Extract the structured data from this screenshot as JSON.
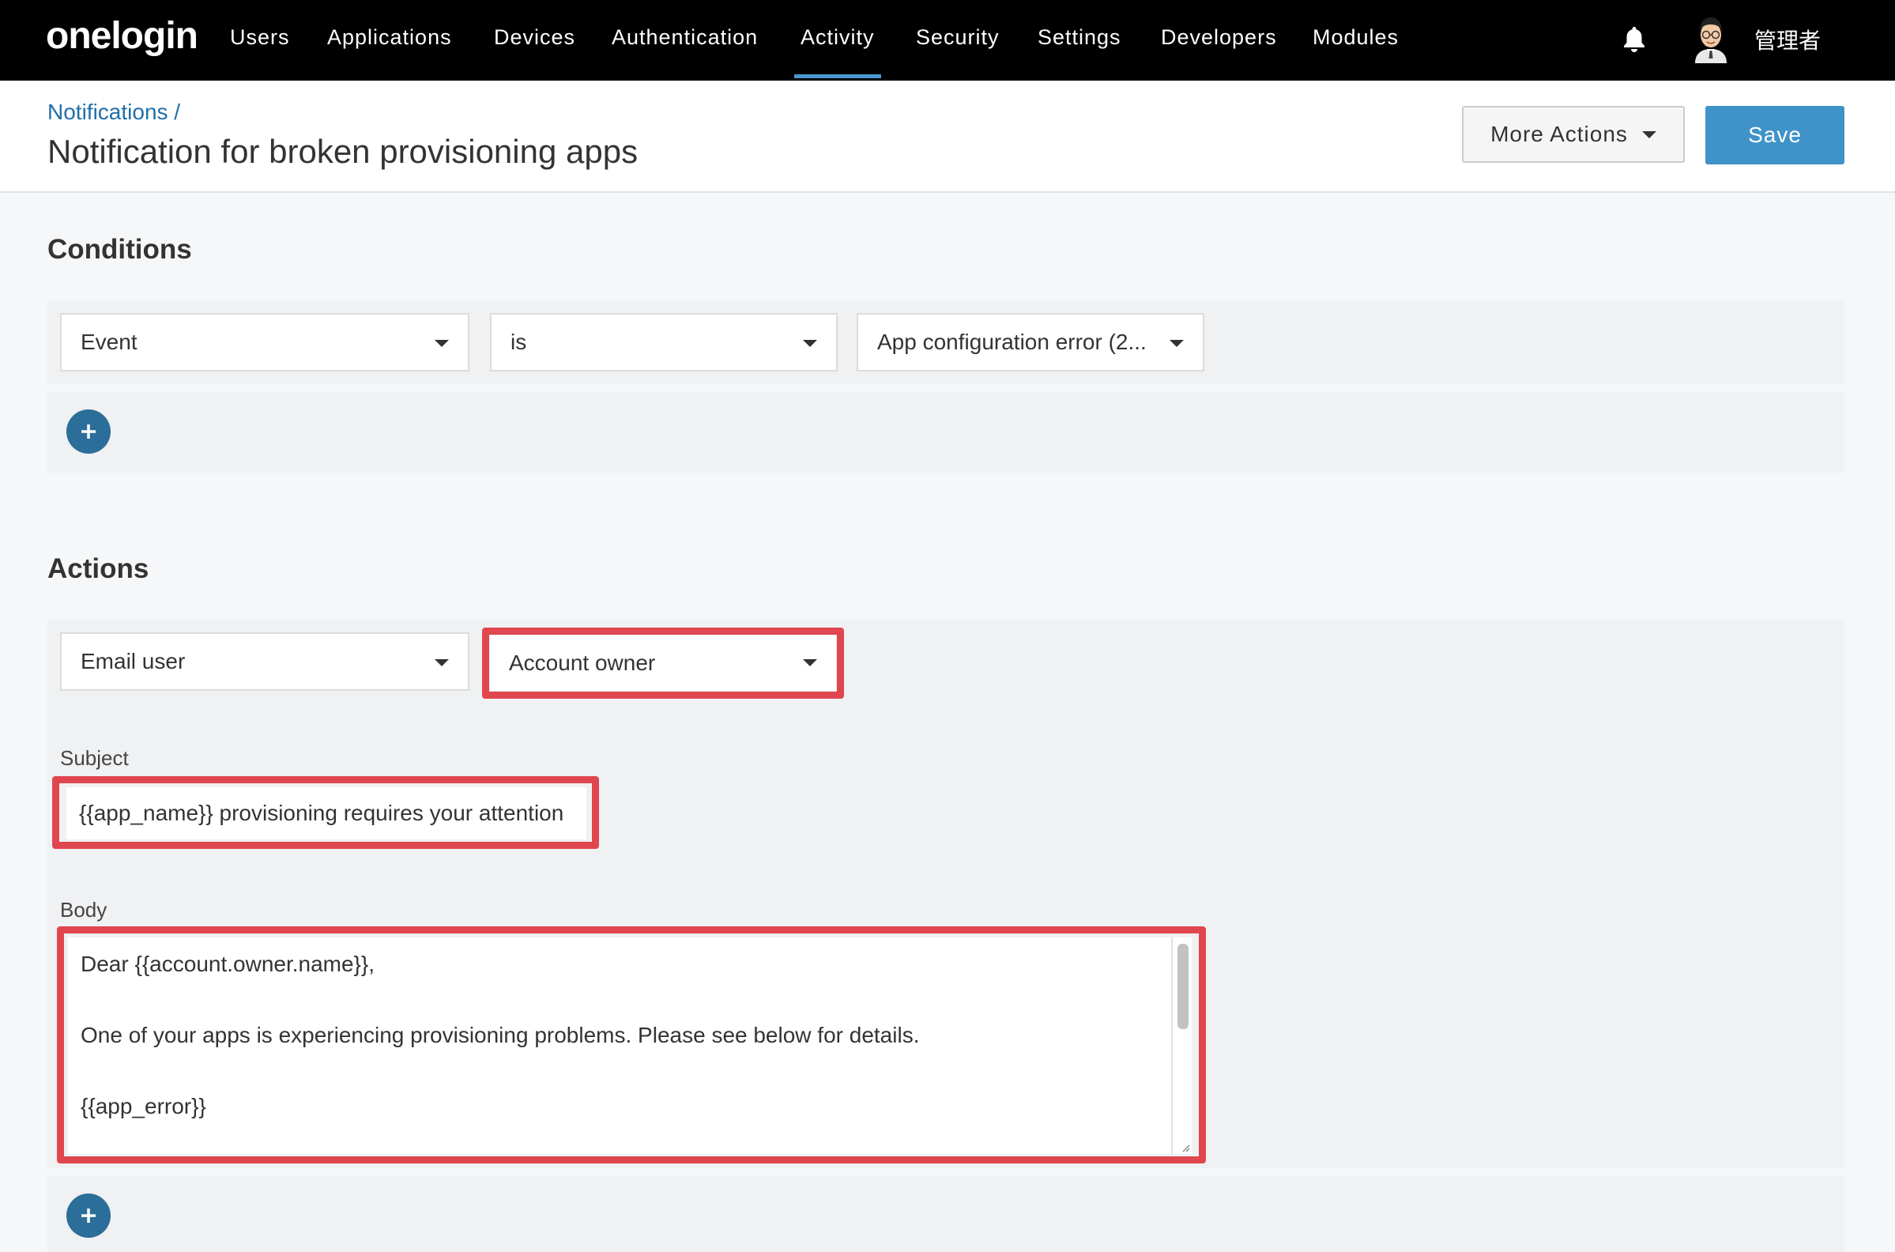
{
  "nav": {
    "logo": "onelogin",
    "items": [
      "Users",
      "Applications",
      "Devices",
      "Authentication",
      "Activity",
      "Security",
      "Settings",
      "Developers",
      "Modules"
    ],
    "active": "Activity",
    "user_name": "管理者",
    "accent_color": "#4a97d1"
  },
  "header": {
    "breadcrumb": "Notifications /",
    "title": "Notification for broken provisioning apps",
    "more_actions": "More Actions",
    "save": "Save"
  },
  "conditions": {
    "title": "Conditions",
    "field": "Event",
    "operator": "is",
    "value": "App configuration error (2..."
  },
  "actions": {
    "title": "Actions",
    "action_type": "Email user",
    "recipient": "Account owner",
    "subject_label": "Subject",
    "subject_value": "{{app_name}} provisioning requires your attention",
    "body_label": "Body",
    "body_lines": [
      "Dear {{account.owner.name}},",
      "One of your apps is experiencing provisioning problems. Please see below for details.",
      "{{app_error}}"
    ]
  },
  "colors": {
    "highlight": "#e0464f",
    "save_button": "#3f93c9",
    "plus_button": "#2b6e99"
  }
}
